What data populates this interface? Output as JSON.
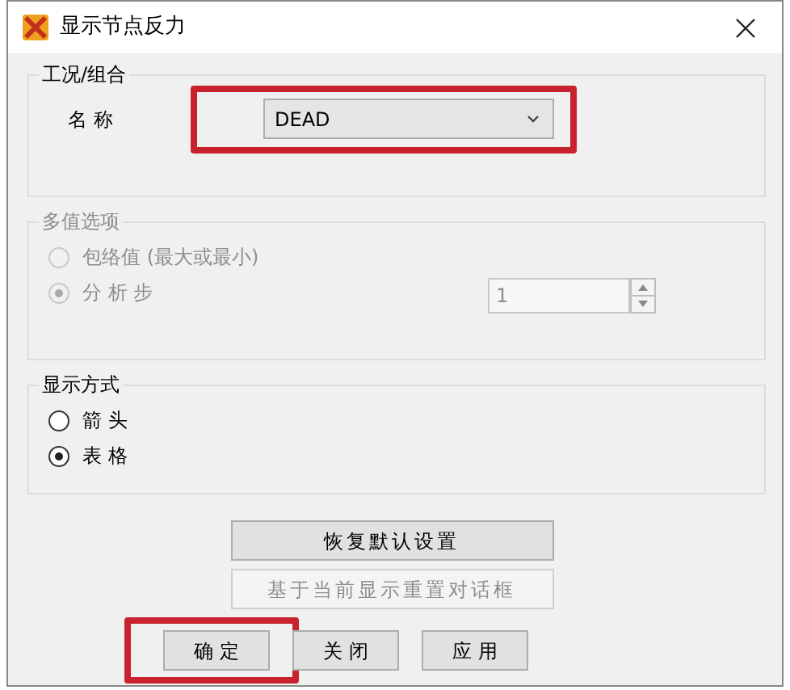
{
  "window": {
    "title": "显示节点反力"
  },
  "load_case": {
    "legend": "工况/组合",
    "name_label": "名 称",
    "combo_value": "DEAD",
    "highlighted": true
  },
  "multi_value": {
    "legend": "多值选项",
    "disabled": true,
    "options": [
      {
        "label": "包络值 (最大或最小)",
        "selected": false
      },
      {
        "label": "分 析 步",
        "selected": true
      }
    ],
    "spin_value": "1"
  },
  "display_mode": {
    "legend": "显示方式",
    "options": [
      {
        "label": "箭 头",
        "selected": false
      },
      {
        "label": "表 格",
        "selected": true
      }
    ]
  },
  "buttons": [
    {
      "label": "恢复默认设置",
      "disabled": false
    },
    {
      "label": "基于当前显示重置对话框",
      "disabled": true
    }
  ],
  "footer_buttons": [
    {
      "label": "确 定",
      "highlighted": true
    },
    {
      "label": "关 闭",
      "highlighted": false
    },
    {
      "label": "应 用",
      "highlighted": false
    }
  ]
}
